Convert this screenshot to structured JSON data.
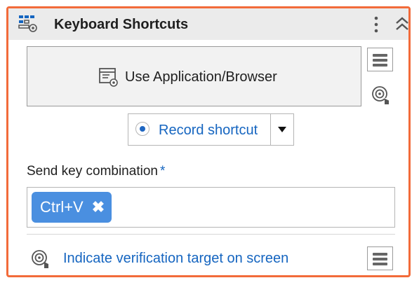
{
  "activity": {
    "title": "Keyboard Shortcuts",
    "icon": "keyboard-shortcuts-icon",
    "accent_color": "#f26b3a"
  },
  "target": {
    "label": "Use Application/Browser",
    "icon": "application-browser-icon"
  },
  "record": {
    "label": "Record shortcut",
    "selected": true
  },
  "send_keys": {
    "label": "Send key combination",
    "required_marker": "*",
    "chips": [
      "Ctrl+V"
    ],
    "remove_icon": "✖"
  },
  "verify": {
    "label": "Indicate verification target on screen",
    "icon": "target-aim-icon"
  },
  "colors": {
    "link": "#1565c0",
    "chip": "#4a8fe0",
    "header_bg": "#ebebeb"
  }
}
